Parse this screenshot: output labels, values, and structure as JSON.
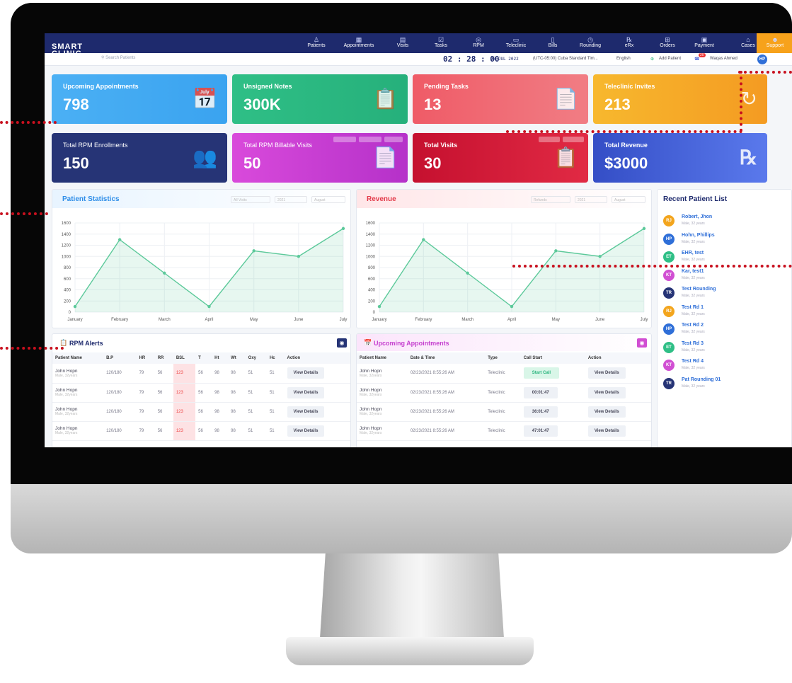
{
  "brand": {
    "line1": "SMART",
    "line2": "CLINIC"
  },
  "nav": [
    {
      "label": "Patients",
      "icon": "♙"
    },
    {
      "label": "Appointments",
      "icon": "▦"
    },
    {
      "label": "Visits",
      "icon": "▤"
    },
    {
      "label": "Tasks",
      "icon": "☑"
    },
    {
      "label": "RPM",
      "icon": "◎"
    },
    {
      "label": "Teleclinic",
      "icon": "▭"
    },
    {
      "label": "Bills",
      "icon": "▯"
    },
    {
      "label": "Rounding",
      "icon": "◷"
    },
    {
      "label": "eRx",
      "icon": "℞"
    },
    {
      "label": "Orders",
      "icon": "⊞"
    },
    {
      "label": "Payment",
      "icon": "▣"
    },
    {
      "label": "Cases",
      "icon": "⌂"
    },
    {
      "label": "Support",
      "icon": "☻"
    }
  ],
  "subbar": {
    "search_placeholder": "Search Patients",
    "clock": "02 : 28 : 00",
    "date": "28 JUL 2022",
    "timezone": "(UTC-05:00) Cuba Standard Tim...",
    "language": "English",
    "add_patient": "Add Patient",
    "notif_count": "20",
    "user_name": "Waqas Ahmed",
    "user_initials": "HP"
  },
  "cards": [
    {
      "title": "Upcoming Appointments",
      "value": "798",
      "icon": "calendar-icon"
    },
    {
      "title": "Unsigned Notes",
      "value": "300K",
      "icon": "notes-icon"
    },
    {
      "title": "Pending Tasks",
      "value": "13",
      "icon": "tasks-icon"
    },
    {
      "title": "Teleclinic Invites",
      "value": "213",
      "icon": "dollar-refresh-icon"
    },
    {
      "title": "Total RPM Enrollments",
      "value": "150",
      "icon": "enrollment-icon"
    },
    {
      "title": "Total RPM Billable Visits",
      "value": "50",
      "icon": "rpm-icon"
    },
    {
      "title": "Total Visits",
      "value": "30",
      "icon": "visits-icon"
    },
    {
      "title": "Total Revenue",
      "value": "$3000",
      "icon": "rx-icon"
    }
  ],
  "patient_stats": {
    "title": "Patient Statistics",
    "filters": [
      "All Visits",
      "2021",
      "August"
    ]
  },
  "revenue": {
    "title": "Revenue",
    "filters": [
      "Refunds",
      "2021",
      "August"
    ]
  },
  "chart_data": [
    {
      "type": "area",
      "title": "Patient Statistics",
      "categories": [
        "January",
        "February",
        "March",
        "April",
        "May",
        "June",
        "July"
      ],
      "x_points": [
        0,
        1,
        2,
        3,
        4,
        5,
        6
      ],
      "series": [
        {
          "values": [
            100,
            1300,
            700,
            100,
            1100,
            1000,
            1500
          ]
        }
      ],
      "ylim": [
        0,
        1600
      ],
      "yticks": [
        0,
        200,
        400,
        600,
        800,
        1000,
        1200,
        1400,
        1600
      ],
      "grid": true,
      "color": "#5cc99a"
    },
    {
      "type": "area",
      "title": "Revenue",
      "categories": [
        "January",
        "February",
        "March",
        "April",
        "May",
        "June",
        "July"
      ],
      "series": [
        {
          "values": [
            100,
            1300,
            700,
            100,
            1100,
            1000,
            1500
          ]
        }
      ],
      "ylim": [
        0,
        1600
      ],
      "yticks": [
        0,
        200,
        400,
        600,
        800,
        1000,
        1200,
        1400,
        1600
      ],
      "grid": true,
      "color": "#5cc99a"
    }
  ],
  "recent": {
    "title": "Recent Patient List",
    "items": [
      {
        "initials": "RJ",
        "name": "Robert, Jhon",
        "sub": "Male, 32 years",
        "color": "#f3a51d"
      },
      {
        "initials": "HP",
        "name": "Hohn, Phillips",
        "sub": "Male, 32 years",
        "color": "#2f6fd8"
      },
      {
        "initials": "ET",
        "name": "EHR, test",
        "sub": "Male, 32 years",
        "color": "#2fbf86"
      },
      {
        "initials": "KT",
        "name": "Kar, test1",
        "sub": "Male, 32 years",
        "color": "#d14fd3"
      },
      {
        "initials": "TR",
        "name": "Test Rounding",
        "sub": "Male, 32 years",
        "color": "#263476"
      },
      {
        "initials": "RJ",
        "name": "Test Rd 1",
        "sub": "Male, 32 years",
        "color": "#f3a51d"
      },
      {
        "initials": "HP",
        "name": "Test Rd 2",
        "sub": "Male, 32 years",
        "color": "#2f6fd8"
      },
      {
        "initials": "ET",
        "name": "Test Rd 3",
        "sub": "Male, 32 years",
        "color": "#2fbf86"
      },
      {
        "initials": "KT",
        "name": "Test Rd 4",
        "sub": "Male, 32 years",
        "color": "#d14fd3"
      },
      {
        "initials": "TR",
        "name": "Pat Rounding 01",
        "sub": "Male, 32 years",
        "color": "#263476"
      }
    ]
  },
  "rpm_alerts": {
    "title": "RPM Alerts",
    "columns": [
      "Patient Name",
      "B.P",
      "HR",
      "RR",
      "BSL",
      "T",
      "Ht",
      "Wt",
      "Oxy",
      "Hc",
      "Action"
    ],
    "rows": [
      {
        "name": "John Hopn",
        "sub": "Male, 32years",
        "bp": "120/180",
        "hr": "79",
        "rr": "56",
        "bsl": "123",
        "t": "56",
        "ht": "98",
        "wt": "98",
        "oxy": "51",
        "hc": "51",
        "action": "View Details"
      },
      {
        "name": "John Hopn",
        "sub": "Male, 32years",
        "bp": "120/180",
        "hr": "79",
        "rr": "56",
        "bsl": "123",
        "t": "56",
        "ht": "98",
        "wt": "98",
        "oxy": "51",
        "hc": "51",
        "action": "View Details"
      },
      {
        "name": "John Hopn",
        "sub": "Male, 32years",
        "bp": "120/180",
        "hr": "79",
        "rr": "56",
        "bsl": "123",
        "t": "56",
        "ht": "98",
        "wt": "98",
        "oxy": "51",
        "hc": "51",
        "action": "View Details"
      },
      {
        "name": "John Hopn",
        "sub": "Male, 32years",
        "bp": "120/180",
        "hr": "79",
        "rr": "56",
        "bsl": "123",
        "t": "56",
        "ht": "98",
        "wt": "98",
        "oxy": "51",
        "hc": "51",
        "action": "View Details"
      }
    ]
  },
  "upcoming": {
    "title": "Upcoming Appointments",
    "columns": [
      "Patient Name",
      "Date & Time",
      "Type",
      "Call Start",
      "Action"
    ],
    "rows": [
      {
        "name": "John Hopn",
        "sub": "Male, 32years",
        "datetime": "02/23/2021  8:55:26 AM",
        "type": "Teleclinic",
        "call": "Start Call",
        "action": "View Details"
      },
      {
        "name": "John Hopn",
        "sub": "Male, 32years",
        "datetime": "02/23/2021  8:55:26 AM",
        "type": "Teleclinic",
        "call": "00:01:47",
        "action": "View Details"
      },
      {
        "name": "John Hopn",
        "sub": "Male, 32years",
        "datetime": "02/23/2021  8:55:26 AM",
        "type": "Teleclinic",
        "call": "36:01:47",
        "action": "View Details"
      },
      {
        "name": "John Hopn",
        "sub": "Male, 32years",
        "datetime": "02/23/2021  8:55:26 AM",
        "type": "Teleclinic",
        "call": "47:01:47",
        "action": "View Details"
      }
    ]
  }
}
